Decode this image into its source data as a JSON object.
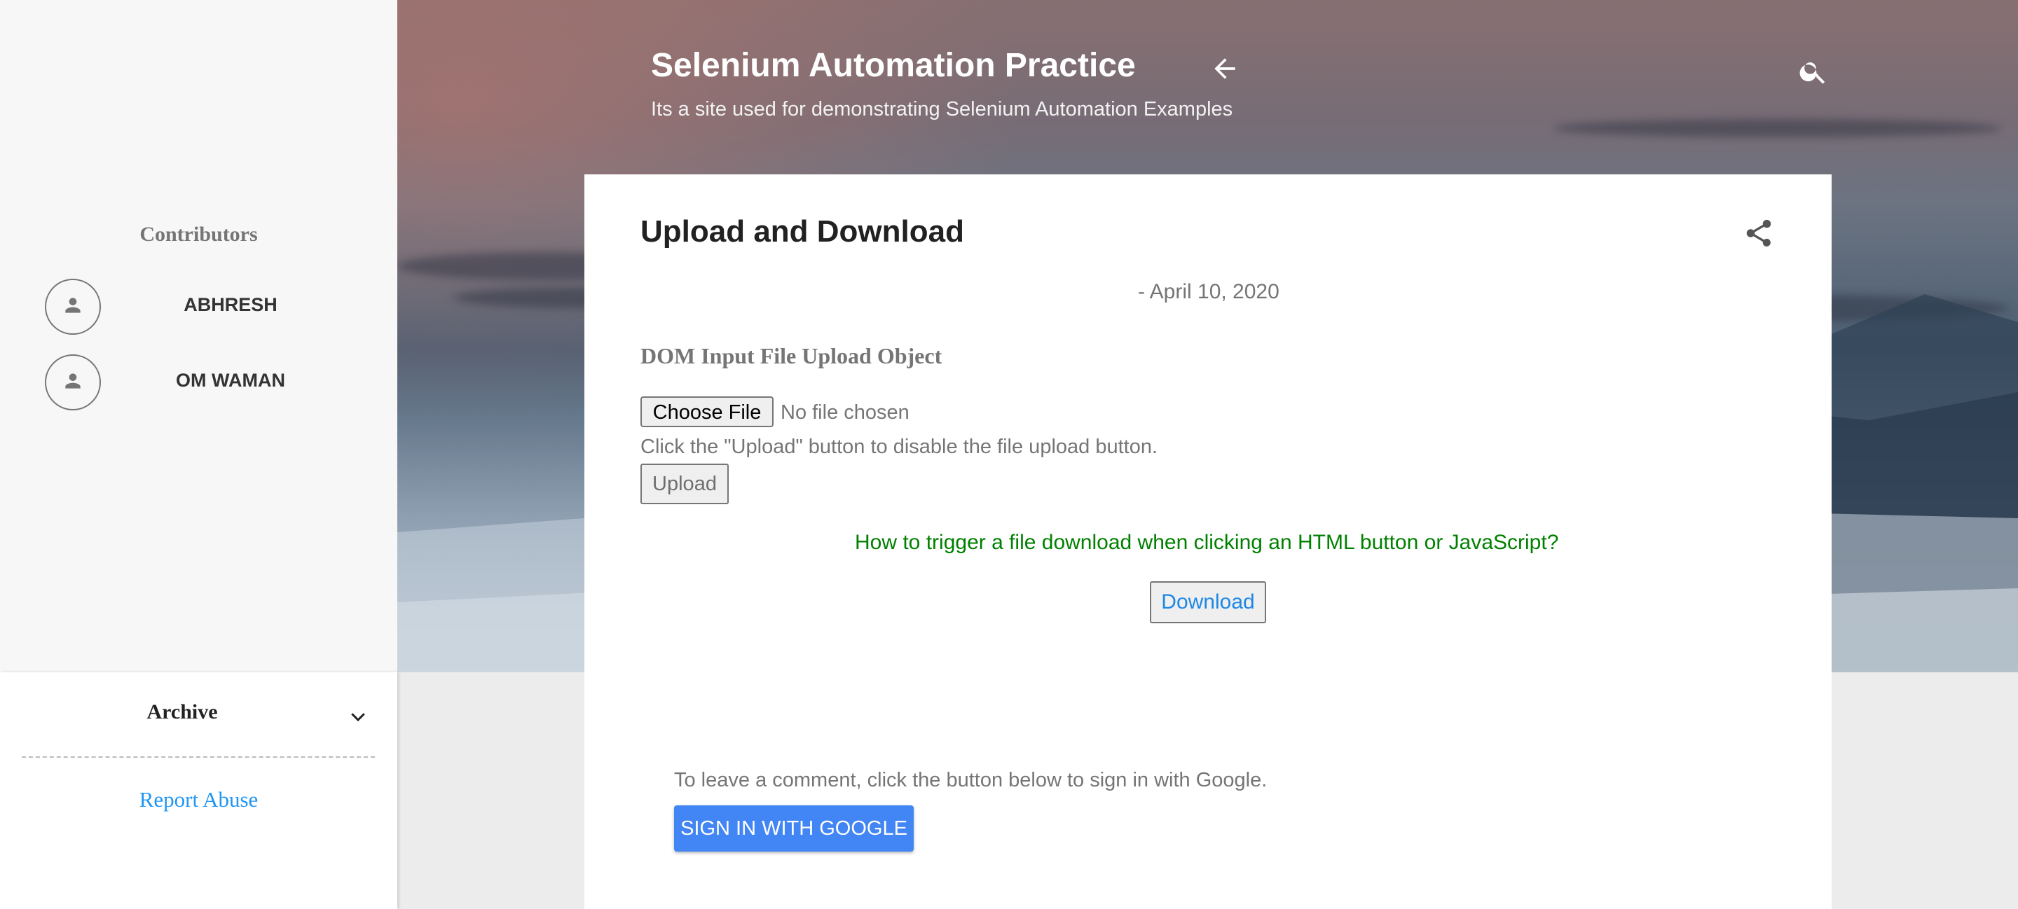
{
  "header": {
    "title": "Selenium Automation Practice",
    "description": "Its a site used for demonstrating Selenium Automation Examples"
  },
  "sidebar": {
    "contributors_title": "Contributors",
    "contributors": [
      {
        "name": "ABHRESH",
        "icon": "person-icon"
      },
      {
        "name": "OM WAMAN",
        "icon": "person-icon"
      }
    ],
    "archive_title": "Archive",
    "report_abuse": "Report Abuse"
  },
  "post": {
    "title": "Upload and Download",
    "date": "- April 10, 2020",
    "section_heading": "DOM Input File Upload Object",
    "choose_file_label": "Choose File",
    "no_file_text": "No file chosen",
    "instruction": "Click the \"Upload\" button to disable the file upload button.",
    "upload_label": "Upload",
    "download_question": "How to trigger a file download when clicking an HTML button or JavaScript?",
    "download_label": "Download"
  },
  "comments": {
    "hint": "To leave a comment, click the button below to sign in with Google.",
    "signin_label": "SIGN IN WITH GOOGLE"
  },
  "colors": {
    "accent": "#4285f4",
    "link": "#2196f3",
    "question_green": "#008000"
  }
}
